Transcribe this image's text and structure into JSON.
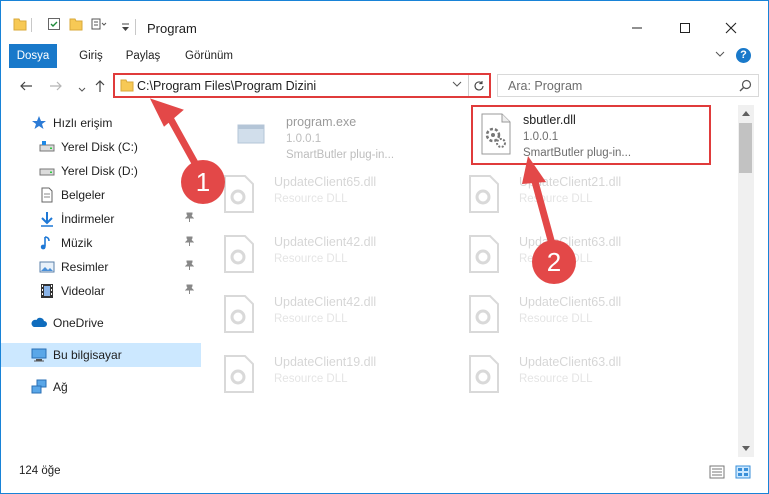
{
  "window": {
    "title": "Program",
    "controls": {
      "minimize": "minimize",
      "maximize": "maximize",
      "close": "close"
    }
  },
  "ribbon": {
    "tabs": [
      {
        "label": "Dosya",
        "active": true
      },
      {
        "label": "Giriş",
        "active": false
      },
      {
        "label": "Paylaş",
        "active": false
      },
      {
        "label": "Görünüm",
        "active": false
      }
    ],
    "help": "?"
  },
  "address": {
    "path": "C:\\Program Files\\Program Dizini"
  },
  "search": {
    "placeholder": "Ara: Program"
  },
  "sidebar": {
    "items": [
      {
        "label": "Hızlı erişim",
        "icon": "star-icon"
      },
      {
        "label": "Yerel Disk (C:)",
        "icon": "drive-icon"
      },
      {
        "label": "Yerel Disk (D:)",
        "icon": "drive-icon"
      },
      {
        "label": "Belgeler",
        "icon": "documents-icon"
      },
      {
        "label": "İndirmeler",
        "icon": "downloads-icon"
      },
      {
        "label": "Müzik",
        "icon": "music-icon"
      },
      {
        "label": "Resimler",
        "icon": "pictures-icon"
      },
      {
        "label": "Videolar",
        "icon": "videos-icon"
      },
      {
        "label": "OneDrive",
        "icon": "cloud-icon"
      },
      {
        "label": "Bu bilgisayar",
        "icon": "computer-icon"
      },
      {
        "label": "Ağ",
        "icon": "network-icon"
      }
    ]
  },
  "files": [
    {
      "name": "program.exe",
      "line1": "1.0.0.1",
      "line2": "SmartButler plug-in..."
    },
    {
      "name": "sbutler.dll",
      "line1": "1.0.0.1",
      "line2": "SmartButler plug-in..."
    },
    {
      "name": "UpdateClient65.dll",
      "line1": "Resource DLL",
      "line2": ""
    },
    {
      "name": "UpdateClient21.dll",
      "line1": "Resource DLL",
      "line2": ""
    },
    {
      "name": "UpdateClient42.dll",
      "line1": "Resource DLL",
      "line2": ""
    },
    {
      "name": "UpdateClient63.dll",
      "line1": "Resource DLL",
      "line2": ""
    },
    {
      "name": "UpdateClient42.dll",
      "line1": "Resource DLL",
      "line2": ""
    },
    {
      "name": "UpdateClient65.dll",
      "line1": "Resource DLL",
      "line2": ""
    },
    {
      "name": "UpdateClient19.dll",
      "line1": "Resource DLL",
      "line2": ""
    },
    {
      "name": "UpdateClient63.dll",
      "line1": "Resource DLL",
      "line2": ""
    }
  ],
  "status": {
    "count": "124 öğe"
  },
  "annotations": [
    {
      "number": "1"
    },
    {
      "number": "2"
    }
  ],
  "colors": {
    "accent": "#1979ca",
    "highlight": "#e03b3b",
    "selection": "#cce8ff"
  }
}
